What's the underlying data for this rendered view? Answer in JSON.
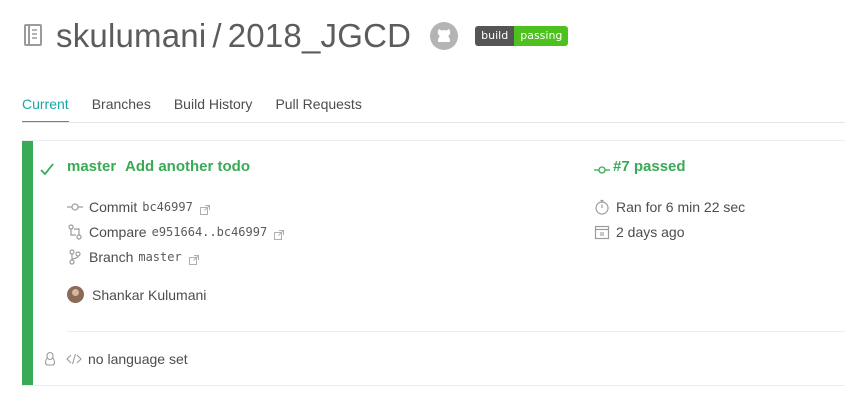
{
  "repo": {
    "owner": "skulumani",
    "separator": "/",
    "name": "2018_JGCD"
  },
  "badge": {
    "left": "build",
    "right": "passing",
    "left_color": "#555555",
    "right_color": "#4dc21e"
  },
  "tabs": [
    {
      "label": "Current",
      "active": true
    },
    {
      "label": "Branches",
      "active": false
    },
    {
      "label": "Build History",
      "active": false
    },
    {
      "label": "Pull Requests",
      "active": false
    }
  ],
  "build": {
    "status": "passed",
    "branch": "master",
    "message": "Add another todo",
    "number_label": "#7 passed",
    "commit_label": "Commit",
    "commit_hash": "bc46997",
    "compare_label": "Compare",
    "compare_range": "e951664..bc46997",
    "branch_label": "Branch",
    "branch_value": "master",
    "author": "Shankar Kulumani",
    "duration": "Ran for 6 min 22 sec",
    "finished": "2 days ago",
    "language": "no language set",
    "status_color": "#39aa56"
  },
  "icons": [
    "repo-icon",
    "github-icon",
    "check-icon",
    "commit-icon",
    "compare-icon",
    "branch-icon",
    "external-link-icon",
    "stopwatch-icon",
    "calendar-icon",
    "linux-icon",
    "code-icon"
  ]
}
